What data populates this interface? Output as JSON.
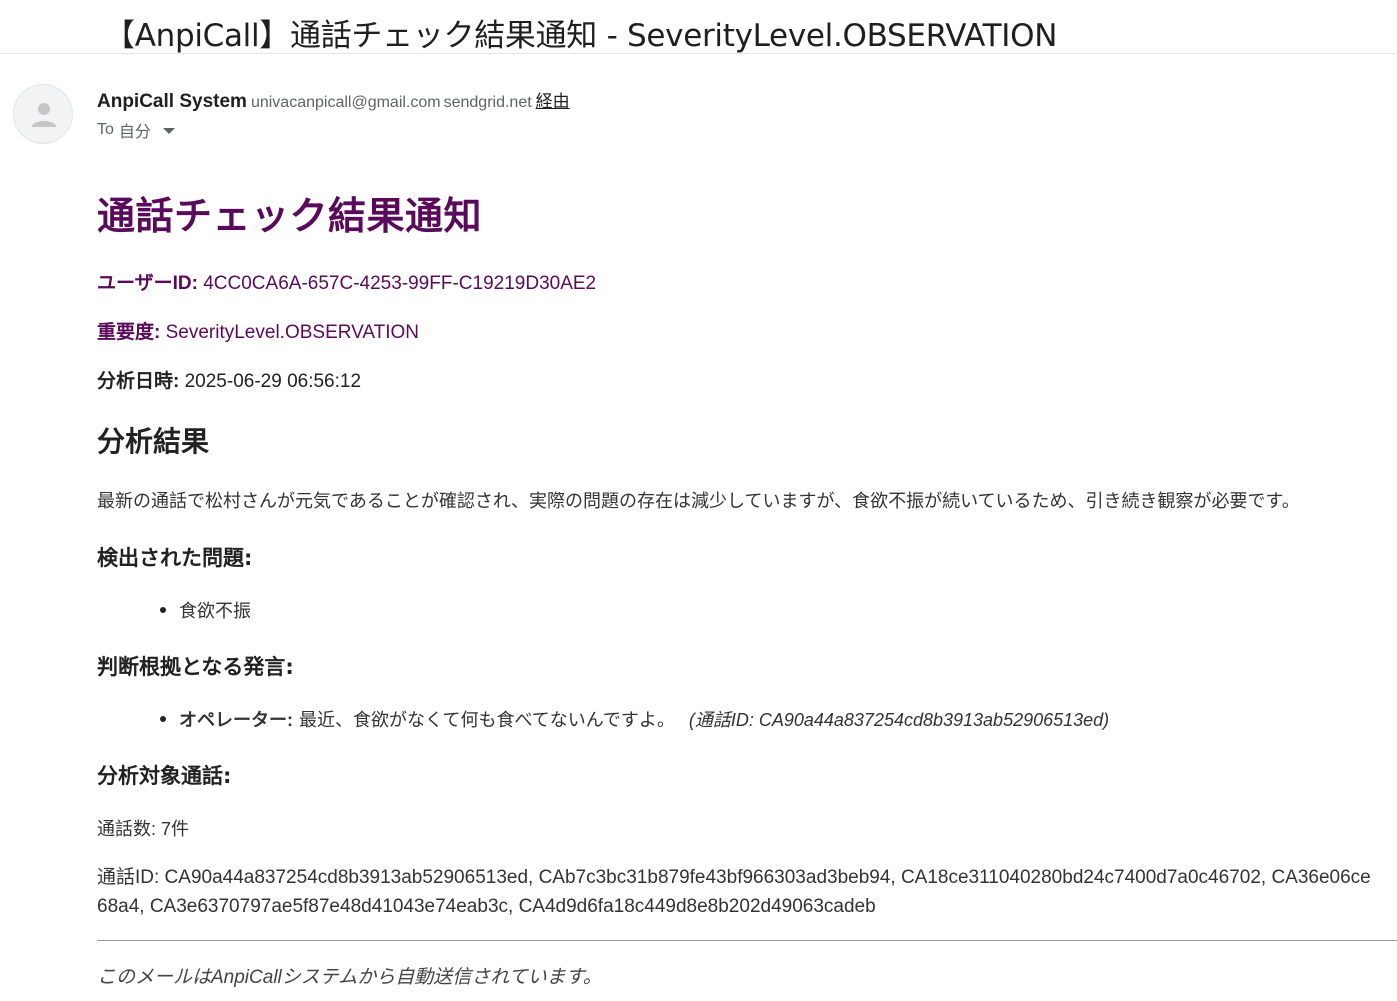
{
  "email": {
    "subject": "【AnpiCall】通話チェック結果通知 - SeverityLevel.OBSERVATION",
    "sender": {
      "name": "AnpiCall System",
      "email": "univacanpicall@gmail.com",
      "via_domain": "sendgrid.net",
      "via_label": "経由"
    },
    "to": {
      "prefix": "To",
      "recipient": "自分"
    }
  },
  "content": {
    "title": "通話チェック結果通知",
    "user_id": {
      "label": "ユーザーID:",
      "value": "4CC0CA6A-657C-4253-99FF-C19219D30AE2"
    },
    "severity": {
      "label": "重要度:",
      "value": "SeverityLevel.OBSERVATION"
    },
    "analysis_time": {
      "label": "分析日時:",
      "value": "2025-06-29 06:56:12"
    },
    "analysis_heading": "分析結果",
    "analysis_text": "最新の通話で松村さんが元気であることが確認され、実際の問題の存在は減少していますが、食欲不振が続いているため、引き続き観察が必要です。",
    "detected_heading": "検出された問題:",
    "detected_issues": [
      "食欲不振"
    ],
    "evidence_heading": "判断根拠となる発言:",
    "evidence": [
      {
        "speaker": "オペレーター:",
        "quote": "最近、食欲がなくて何も食べてないんですよ。",
        "call_ref": "(通話ID: CA90a44a837254cd8b3913ab52906513ed)"
      }
    ],
    "calls_heading": "分析対象通話:",
    "call_count": "通話数: 7件",
    "call_ids": "通話ID: CA90a44a837254cd8b3913ab52906513ed, CAb7c3bc31b879fe43bf966303ad3beb94, CA18ce311040280bd24c7400d7a0c46702, CA36e06ce\n68a4, CA3e6370797ae5f87e48d41043e74eab3c, CA4d9d6fa18c449d8e8b202d49063cadeb",
    "footer": "このメールはAnpiCallシステムから自動送信されています。"
  },
  "colors": {
    "accent_purple": "#5a0a5a",
    "text": "#222222",
    "muted": "#5f6368"
  }
}
